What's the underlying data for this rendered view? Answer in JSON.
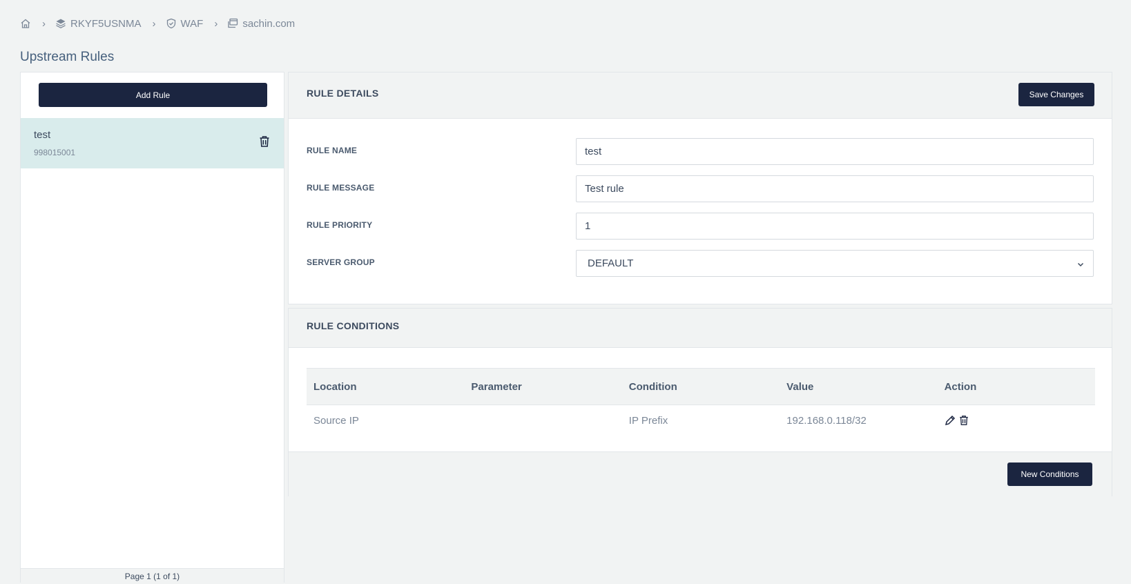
{
  "breadcrumb": {
    "items": [
      {
        "label": "",
        "icon": "home-icon"
      },
      {
        "label": "RKYF5USNMA",
        "icon": "layers-icon"
      },
      {
        "label": "WAF",
        "icon": "shield-icon"
      },
      {
        "label": "sachin.com",
        "icon": "window-icon"
      }
    ],
    "separator": "›"
  },
  "page": {
    "title": "Upstream Rules"
  },
  "left": {
    "add_label": "Add Rule",
    "rules": [
      {
        "name": "test",
        "id": "998015001"
      }
    ],
    "footer_text": "Page 1 (1 of 1)"
  },
  "details": {
    "title": "RULE DETAILS",
    "save_label": "Save Changes",
    "fields": {
      "name": {
        "label": "RULE NAME",
        "value": "test"
      },
      "message": {
        "label": "RULE MESSAGE",
        "value": "Test rule"
      },
      "priority": {
        "label": "RULE PRIORITY",
        "value": "1"
      },
      "group": {
        "label": "SERVER GROUP",
        "value": "DEFAULT",
        "options": [
          "DEFAULT"
        ]
      }
    }
  },
  "conditions": {
    "title": "RULE CONDITIONS",
    "columns": [
      "Location",
      "Parameter",
      "Condition",
      "Value",
      "Action"
    ],
    "rows": [
      {
        "location": "Source IP",
        "parameter": "",
        "condition": "IP Prefix",
        "value": "192.168.0.118/32"
      }
    ],
    "new_label": "New Conditions"
  },
  "colors": {
    "primary": "#1b2540",
    "selected_row": "#d9ecec",
    "background": "#f1f3f3"
  }
}
